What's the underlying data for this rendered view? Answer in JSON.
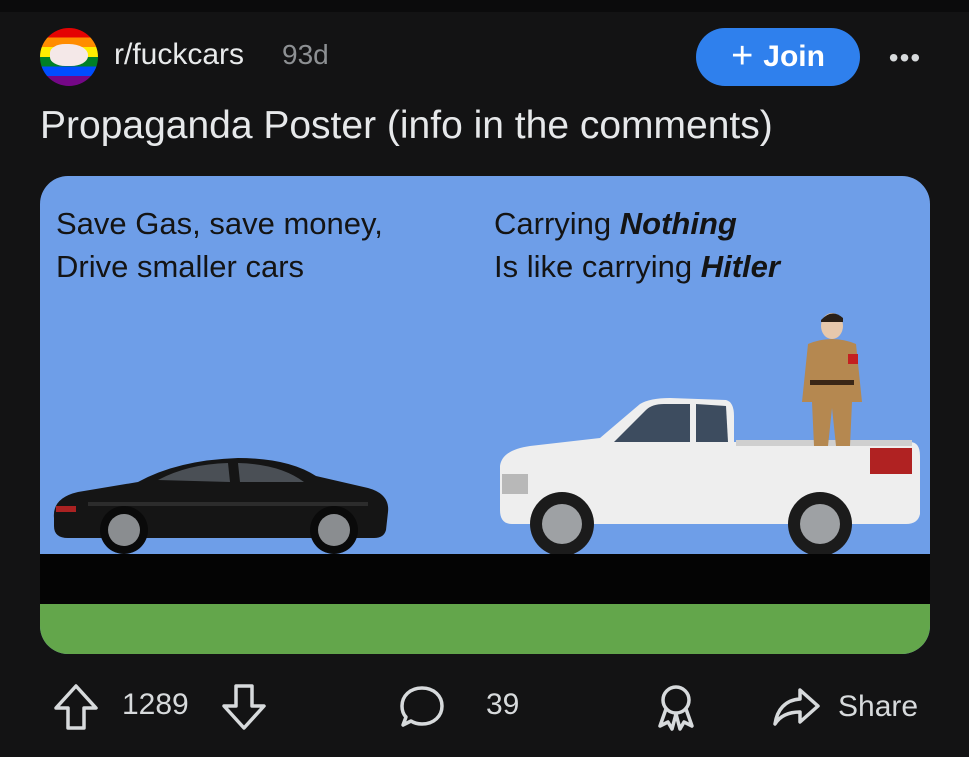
{
  "post": {
    "subreddit": "r/fuckcars",
    "age": "93d",
    "join_label": "Join",
    "more_label": "•••",
    "title": "Propaganda Poster (info in the comments)"
  },
  "poster": {
    "left_line1": "Save Gas, save money,",
    "left_line2": "Drive smaller cars",
    "right_line1_prefix": "Carrying ",
    "right_line1_bold": "Nothing",
    "right_line2_prefix": "Is like carrying ",
    "right_line2_bold": "Hitler",
    "colors": {
      "sky": "#6e9ee8",
      "road": "#040404",
      "grass": "#63a64b"
    }
  },
  "actions": {
    "score": "1289",
    "comments": "39",
    "share_label": "Share"
  },
  "icons": [
    "community-avatar",
    "plus-icon",
    "more-icon",
    "upvote-icon",
    "downvote-icon",
    "comment-icon",
    "award-icon",
    "share-icon"
  ]
}
